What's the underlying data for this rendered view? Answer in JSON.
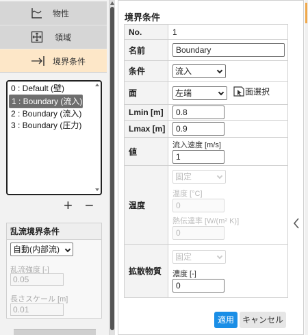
{
  "left_nav": [
    {
      "label": "物性",
      "icon": "chart-icon"
    },
    {
      "label": "領域",
      "icon": "domain-icon"
    },
    {
      "label": "境界条件",
      "icon": "arrow-boundary-icon"
    }
  ],
  "boundary_list": {
    "items": [
      "0 : Default (壁)",
      "1 : Boundary (流入)",
      "2 : Boundary (流入)",
      "3 : Boundary (圧力)"
    ],
    "selected_index": 1,
    "add_label": "+",
    "remove_label": "−"
  },
  "turbulence": {
    "title": "乱流境界条件",
    "mode": "自動(内部流)",
    "intensity_label": "乱流強度 [-]",
    "intensity_value": "0.05",
    "length_label": "長さスケール [m]",
    "length_value": "0.01"
  },
  "panel": {
    "title": "境界条件",
    "no_label": "No.",
    "no_value": "1",
    "name_label": "名前",
    "name_value": "Boundary",
    "condition_label": "条件",
    "condition_value": "流入",
    "face_label": "面",
    "face_value": "左端",
    "face_select_label": "面選択",
    "lmin_label": "Lmin [m]",
    "lmin_value": "0.8",
    "lmax_label": "Lmax [m]",
    "lmax_value": "0.9",
    "value_label": "値",
    "velocity_label": "流入速度 [m/s]",
    "velocity_value": "1",
    "temp_label": "温度",
    "temp_mode": "固定",
    "temp_sub_label": "温度 [°C]",
    "temp_value": "0",
    "heat_label": "熱伝達率 [W/(m² K)]",
    "heat_value": "0",
    "diffusion_label": "拡散物質",
    "diffusion_mode": "固定",
    "conc_label": "濃度 [-]",
    "conc_value": "0",
    "apply_label": "適用",
    "cancel_label": "キャンセル"
  }
}
